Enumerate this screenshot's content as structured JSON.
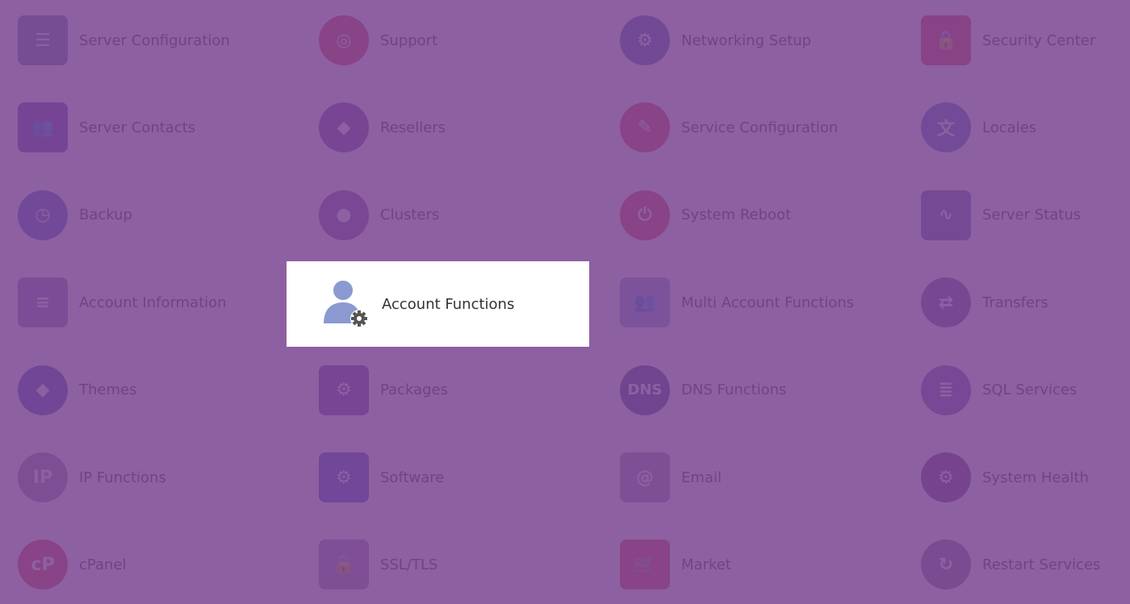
{
  "overlay_color": "#7a4692",
  "items": [
    {
      "label": "Server Configuration",
      "icon": "server-gear-icon",
      "color": "#5a6f9a",
      "shape": "square",
      "glyph": "☰"
    },
    {
      "label": "Support",
      "icon": "lifebuoy-icon",
      "color": "#e0344a",
      "shape": "round",
      "glyph": "◎"
    },
    {
      "label": "Networking Setup",
      "icon": "globe-wrench-icon",
      "color": "#3f5aa8",
      "shape": "round",
      "glyph": "⚙"
    },
    {
      "label": "Security Center",
      "icon": "padlock-icon",
      "color": "#d9344a",
      "shape": "square",
      "glyph": "🔒"
    },
    {
      "label": "Server Contacts",
      "icon": "contacts-chat-icon",
      "color": "#5a3ea8",
      "shape": "square",
      "glyph": "👥"
    },
    {
      "label": "Resellers",
      "icon": "price-tag-icon",
      "color": "#6a40a0",
      "shape": "round",
      "glyph": "◆"
    },
    {
      "label": "Service Configuration",
      "icon": "wrench-icon",
      "color": "#e0344a",
      "shape": "round",
      "glyph": "✎"
    },
    {
      "label": "Locales",
      "icon": "speech-bubbles-icon",
      "color": "#3f6ac0",
      "shape": "round",
      "glyph": "文"
    },
    {
      "label": "Backup",
      "icon": "clock-backup-icon",
      "color": "#3f5ac0",
      "shape": "round",
      "glyph": "◷"
    },
    {
      "label": "Clusters",
      "icon": "cluster-circles-icon",
      "color": "#7a50a8",
      "shape": "round",
      "glyph": "●"
    },
    {
      "label": "System Reboot",
      "icon": "power-icon",
      "color": "#e0344a",
      "shape": "round",
      "glyph": "⏻"
    },
    {
      "label": "Server Status",
      "icon": "monitor-pulse-icon",
      "color": "#5a5aa0",
      "shape": "square",
      "glyph": "∿"
    },
    {
      "label": "Account Information",
      "icon": "id-card-icon",
      "color": "#8a7ab0",
      "shape": "square",
      "glyph": "≡"
    },
    {
      "label": "Account Functions",
      "icon": "user-gear-icon",
      "color": "#8a9ad0",
      "shape": "square",
      "glyph": "👤"
    },
    {
      "label": "Multi Account Functions",
      "icon": "users-gear-icon",
      "color": "#8a9ad0",
      "shape": "square",
      "glyph": "👥"
    },
    {
      "label": "Transfers",
      "icon": "transfer-arrows-icon",
      "color": "#6a50a0",
      "shape": "round",
      "glyph": "⇄"
    },
    {
      "label": "Themes",
      "icon": "paint-drop-icon",
      "color": "#3f4ab0",
      "shape": "round",
      "glyph": "◆"
    },
    {
      "label": "Packages",
      "icon": "box-gear-icon",
      "color": "#6a40a0",
      "shape": "square",
      "glyph": "⚙"
    },
    {
      "label": "DNS Functions",
      "icon": "dns-icon",
      "color": "#3a3a8a",
      "shape": "round",
      "glyph": "DNS"
    },
    {
      "label": "SQL Services",
      "icon": "database-icon",
      "color": "#6a50a8",
      "shape": "round",
      "glyph": "≣"
    },
    {
      "label": "IP Functions",
      "icon": "ip-globe-icon",
      "color": "#8a8aa8",
      "shape": "round",
      "glyph": "IP"
    },
    {
      "label": "Software",
      "icon": "window-gear-icon",
      "color": "#3f4ac0",
      "shape": "square",
      "glyph": "⚙"
    },
    {
      "label": "Email",
      "icon": "envelope-at-icon",
      "color": "#9a8ab0",
      "shape": "square",
      "glyph": "@"
    },
    {
      "label": "System Health",
      "icon": "gear-pulse-icon",
      "color": "#5a3a80",
      "shape": "round",
      "glyph": "⚙"
    },
    {
      "label": "cPanel",
      "icon": "cpanel-logo-icon",
      "color": "#e0344a",
      "shape": "round",
      "glyph": "cP"
    },
    {
      "label": "SSL/TLS",
      "icon": "certificate-lock-icon",
      "color": "#9a8ab0",
      "shape": "square",
      "glyph": "🔒"
    },
    {
      "label": "Market",
      "icon": "shopping-cart-icon",
      "color": "#e0344a",
      "shape": "square",
      "glyph": "🛒"
    },
    {
      "label": "Restart Services",
      "icon": "restart-icon",
      "color": "#7a6a90",
      "shape": "round",
      "glyph": "↻"
    }
  ]
}
